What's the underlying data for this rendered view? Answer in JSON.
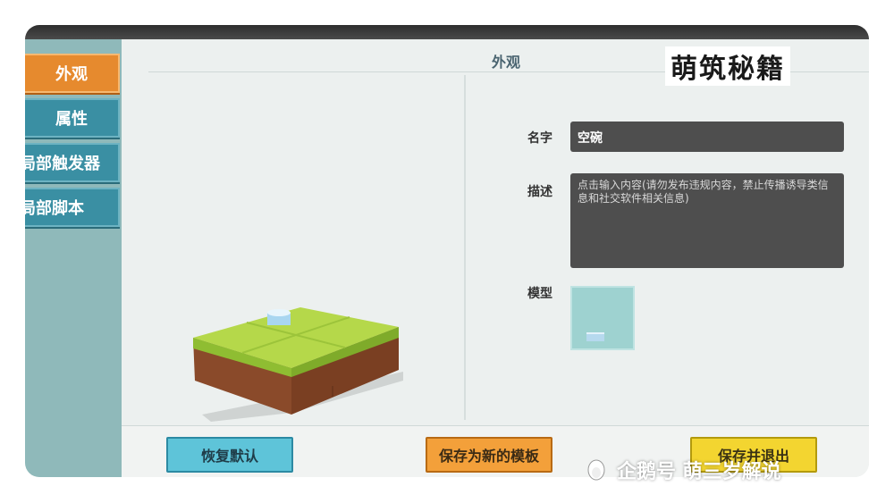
{
  "sidebar": {
    "items": [
      {
        "label": "外观",
        "active": true
      },
      {
        "label": "属性",
        "active": false
      },
      {
        "label": "局部触发器",
        "active": false
      },
      {
        "label": "局部脚本",
        "active": false
      }
    ]
  },
  "panel": {
    "title": "外观",
    "logo_text": "萌筑秘籍"
  },
  "fields": {
    "name_label": "名字",
    "name_value": "空碗",
    "desc_label": "描述",
    "desc_placeholder": "点击输入内容(请勿发布违规内容，禁止传播诱导类信息和社交软件相关信息)",
    "model_label": "模型"
  },
  "buttons": {
    "reset": "恢复默认",
    "save_template": "保存为新的模板",
    "save": "保存并退出"
  },
  "watermark": {
    "text": "企鹅号 萌三岁解说"
  },
  "colors": {
    "sidebar_bg": "#8fb9ba",
    "tab_active": "#e68a2e",
    "tab_inactive": "#3a8fa3",
    "input_bg": "#4e4e4e",
    "reset_btn": "#5ec4d9",
    "template_btn": "#f3a03a",
    "save_btn": "#f3d530"
  }
}
